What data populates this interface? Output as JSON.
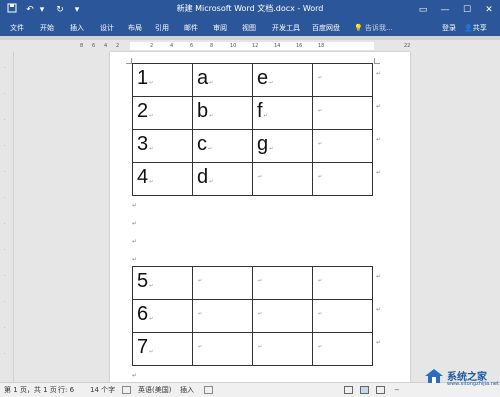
{
  "window": {
    "title": "新建 Microsoft Word 文档.docx - Word",
    "controls": [
      "restore-down",
      "minimize",
      "maximize",
      "close"
    ]
  },
  "quick_access": [
    "save-icon",
    "undo-icon",
    "redo-icon",
    "customize-icon"
  ],
  "ribbon": {
    "tabs": [
      "文件",
      "开始",
      "插入",
      "设计",
      "布局",
      "引用",
      "邮件",
      "审阅",
      "视图",
      "开发工具",
      "百度网盘"
    ],
    "tell_me": "告诉我...",
    "login": "登录",
    "share": "共享"
  },
  "ruler": {
    "ticks": [
      "8",
      "6",
      "4",
      "2",
      "2",
      "4",
      "6",
      "8",
      "10",
      "12",
      "14",
      "16",
      "18",
      "22"
    ]
  },
  "document": {
    "table1": [
      [
        "1",
        "a",
        "e",
        ""
      ],
      [
        "2",
        "b",
        "f",
        ""
      ],
      [
        "3",
        "c",
        "g",
        ""
      ],
      [
        "4",
        "d",
        "",
        ""
      ]
    ],
    "table2": [
      [
        "5",
        "",
        "",
        ""
      ],
      [
        "6",
        "",
        "",
        ""
      ],
      [
        "7",
        "",
        "",
        ""
      ]
    ],
    "cell_mark": "↵",
    "para_mark": "↵"
  },
  "statusbar": {
    "page": "第 1 页，共 1 页",
    "line": "行: 6",
    "words": "14 个字",
    "language": "英语(美国)",
    "mode": "插入"
  },
  "watermark": {
    "text": "系统之家",
    "url": "www.xitongzhijia.net"
  }
}
